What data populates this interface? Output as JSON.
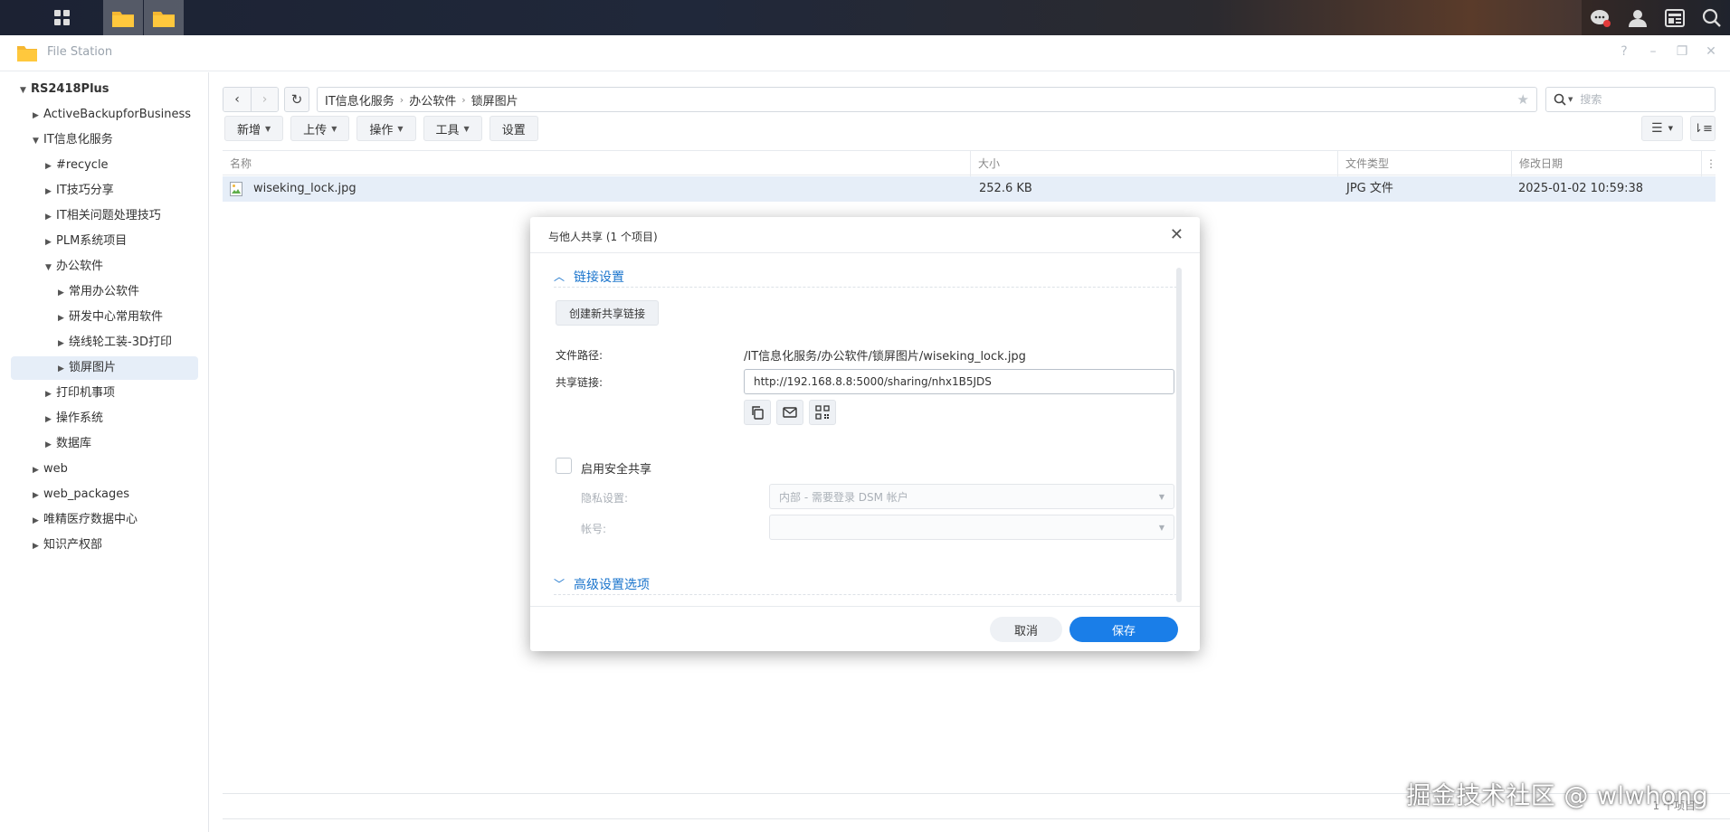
{
  "app": {
    "title": "File Station"
  },
  "taskbar": {
    "left_icons": [
      "grid-icon",
      "folder-icon",
      "folder-icon"
    ],
    "right_icons": [
      "chat-icon",
      "user-icon",
      "widget-icon",
      "search-icon"
    ]
  },
  "sidebar": {
    "items": [
      {
        "label": "RS2418Plus",
        "level": 0,
        "expanded": true
      },
      {
        "label": "ActiveBackupforBusiness",
        "level": 1,
        "expanded": false
      },
      {
        "label": "IT信息化服务",
        "level": 1,
        "expanded": true
      },
      {
        "label": "#recycle",
        "level": 2,
        "expanded": false
      },
      {
        "label": "IT技巧分享",
        "level": 2,
        "expanded": false
      },
      {
        "label": "IT相关问题处理技巧",
        "level": 2,
        "expanded": false
      },
      {
        "label": "PLM系统项目",
        "level": 2,
        "expanded": false
      },
      {
        "label": "办公软件",
        "level": 2,
        "expanded": true
      },
      {
        "label": "常用办公软件",
        "level": 3,
        "expanded": false
      },
      {
        "label": "研发中心常用软件",
        "level": 3,
        "expanded": false
      },
      {
        "label": "绕线轮工装-3D打印",
        "level": 3,
        "expanded": false
      },
      {
        "label": "锁屏图片",
        "level": 3,
        "expanded": false,
        "selected": true
      },
      {
        "label": "打印机事项",
        "level": 2,
        "expanded": false
      },
      {
        "label": "操作系统",
        "level": 2,
        "expanded": false
      },
      {
        "label": "数据库",
        "level": 2,
        "expanded": false
      },
      {
        "label": "web",
        "level": 1,
        "expanded": false
      },
      {
        "label": "web_packages",
        "level": 1,
        "expanded": false
      },
      {
        "label": "唯精医疗数据中心",
        "level": 1,
        "expanded": false
      },
      {
        "label": "知识产权部",
        "level": 1,
        "expanded": false
      }
    ]
  },
  "path": {
    "segments": [
      "IT信息化服务",
      "办公软件",
      "锁屏图片"
    ]
  },
  "search": {
    "placeholder": "搜索"
  },
  "toolbar": {
    "create": "新增",
    "upload": "上传",
    "action": "操作",
    "tools": "工具",
    "settings": "设置"
  },
  "table": {
    "headers": {
      "name": "名称",
      "size": "大小",
      "type": "文件类型",
      "modified": "修改日期"
    },
    "rows": [
      {
        "name": "wiseking_lock.jpg",
        "size": "252.6 KB",
        "type": "JPG 文件",
        "modified": "2025-01-02 10:59:38"
      }
    ]
  },
  "status": {
    "item_count": "1 个项目"
  },
  "watermark": "掘金技术社区 @ wlwhong",
  "dialog": {
    "title": "与他人共享 (1 个项目)",
    "section_link": "链接设置",
    "create_link_button": "创建新共享链接",
    "file_path_label": "文件路径:",
    "file_path_value": "/IT信息化服务/办公软件/锁屏图片/wiseking_lock.jpg",
    "share_link_label": "共享链接:",
    "share_link_value": "http://192.168.8.8:5000/sharing/nhx1B5JDS",
    "secure_share_label": "启用安全共享",
    "privacy_label": "隐私设置:",
    "privacy_value": "内部 - 需要登录 DSM 帐户",
    "account_label": "帐号:",
    "section_advanced": "高级设置选项",
    "cancel_button": "取消",
    "save_button": "保存"
  },
  "colors": {
    "accent": "#1a7ee8",
    "selection": "#e6eef8"
  }
}
